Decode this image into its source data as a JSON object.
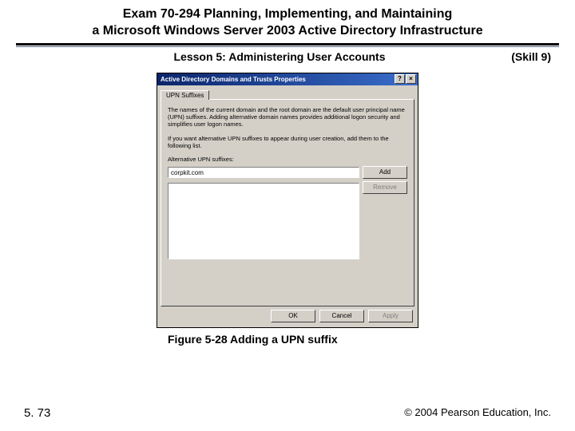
{
  "header": {
    "line1": "Exam 70-294 Planning, Implementing, and Maintaining",
    "line2": "a Microsoft Windows Server 2003 Active Directory Infrastructure"
  },
  "lesson": {
    "title": "Lesson 5: Administering User Accounts",
    "skill": "(Skill 9)"
  },
  "dialog": {
    "title": "Active Directory Domains and Trusts Properties",
    "help_btn": "?",
    "close_btn": "×",
    "tab": "UPN Suffixes",
    "desc1": "The names of the current domain and the root domain are the default user principal name (UPN) suffixes. Adding alternative domain names provides additional logon security and simplifies user logon names.",
    "desc2": "If you want alternative UPN suffixes to appear during user creation, add them to the following list.",
    "label": "Alternative UPN suffixes:",
    "input_value": "corpkit.com",
    "add_btn": "Add",
    "remove_btn": "Remove",
    "ok_btn": "OK",
    "cancel_btn": "Cancel",
    "apply_btn": "Apply"
  },
  "caption": "Figure 5-28 Adding a UPN suffix",
  "footer": {
    "page": "5. 73",
    "copyright": "© 2004 Pearson Education, Inc."
  }
}
